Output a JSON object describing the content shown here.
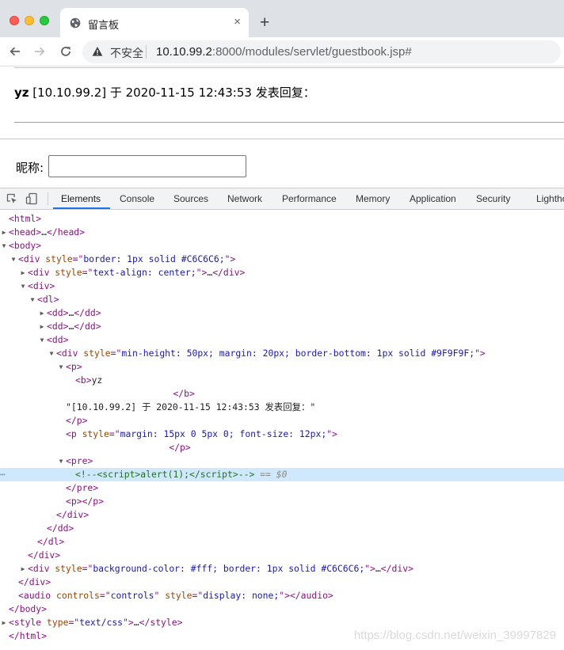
{
  "browser": {
    "tab_title": "留言板",
    "tab_close": "×",
    "new_tab": "+",
    "insecure_label": "不安全",
    "url_host": "10.10.99.2",
    "url_rest": ":8000/modules/servlet/guestbook.jsp#"
  },
  "page": {
    "reply_author": "yz",
    "reply_text": " [10.10.99.2] 于 2020-11-15 12:43:53 发表回复：",
    "nick_label": "昵称:",
    "nick_value": ""
  },
  "devtools": {
    "tabs": [
      "Elements",
      "Console",
      "Sources",
      "Network",
      "Performance",
      "Memory",
      "Application",
      "Security",
      "Lighthouse"
    ],
    "active_tab": "Elements"
  },
  "dom_lines": [
    {
      "depth": 0,
      "arrow": "",
      "html": "<span class=\"tag\">&lt;html&gt;</span>"
    },
    {
      "depth": 0,
      "arrow": "▶",
      "html": "<span class=\"tag\">&lt;head&gt;</span>…<span class=\"tag\">&lt;/head&gt;</span>"
    },
    {
      "depth": 0,
      "arrow": "▼",
      "html": "<span class=\"tag\">&lt;body&gt;</span>"
    },
    {
      "depth": 1,
      "arrow": "▼",
      "html": "<span class=\"tag\">&lt;div </span><span class=\"attr\">style</span><span class=\"tag\">=\"</span><span class=\"val\">border: 1px solid #C6C6C6;</span><span class=\"tag\">\"&gt;</span>"
    },
    {
      "depth": 2,
      "arrow": "▶",
      "html": "<span class=\"tag\">&lt;div </span><span class=\"attr\">style</span><span class=\"tag\">=\"</span><span class=\"val\">text-align: center;</span><span class=\"tag\">\"&gt;</span>…<span class=\"tag\">&lt;/div&gt;</span>"
    },
    {
      "depth": 2,
      "arrow": "▼",
      "html": "<span class=\"tag\">&lt;div&gt;</span>"
    },
    {
      "depth": 3,
      "arrow": "▼",
      "html": "<span class=\"tag\">&lt;dl&gt;</span>"
    },
    {
      "depth": 4,
      "arrow": "▶",
      "html": "<span class=\"tag\">&lt;dd&gt;</span>…<span class=\"tag\">&lt;/dd&gt;</span>"
    },
    {
      "depth": 4,
      "arrow": "▶",
      "html": "<span class=\"tag\">&lt;dd&gt;</span>…<span class=\"tag\">&lt;/dd&gt;</span>"
    },
    {
      "depth": 4,
      "arrow": "▼",
      "html": "<span class=\"tag\">&lt;dd&gt;</span>"
    },
    {
      "depth": 5,
      "arrow": "▼",
      "html": "<span class=\"tag\">&lt;div </span><span class=\"attr\">style</span><span class=\"tag\">=\"</span><span class=\"val\">min-height: 50px; margin: 20px; border-bottom: 1px solid #9F9F9F;</span><span class=\"tag\">\"&gt;</span>"
    },
    {
      "depth": 6,
      "arrow": "▼",
      "html": "<span class=\"tag\">&lt;p&gt;</span>"
    },
    {
      "depth": 7,
      "arrow": "",
      "html": "<span class=\"tag\">&lt;b&gt;</span><span class=\"txt\">yz</span>"
    },
    {
      "depth": 7,
      "arrow": "",
      "html": "                  <span class=\"tag\">&lt;/b&gt;</span>"
    },
    {
      "depth": 7,
      "arrow": "",
      "pad": -12,
      "html": "<span class=\"txt\">\"[10.10.99.2] 于 2020-11-15 12:43:53 发表回复：\"</span>"
    },
    {
      "depth": 6,
      "arrow": "",
      "html": "<span class=\"tag\">&lt;/p&gt;</span>"
    },
    {
      "depth": 6,
      "arrow": "",
      "html": "<span class=\"tag\">&lt;p </span><span class=\"attr\">style</span><span class=\"tag\">=\"</span><span class=\"val\">margin: 15px 0 5px 0; font-size: 12px;</span><span class=\"tag\">\"&gt;</span>"
    },
    {
      "depth": 6,
      "arrow": "",
      "html": "                   <span class=\"tag\">&lt;/p&gt;</span>"
    },
    {
      "depth": 6,
      "arrow": "▼",
      "html": "<span class=\"tag\">&lt;pre&gt;</span>"
    },
    {
      "depth": 7,
      "arrow": "",
      "sel": true,
      "html": "<span class=\"cmt\">&lt;!--&lt;script&gt;alert(1);&lt;/script&gt;--&gt;</span> <span class=\"dollar\">== $0</span>"
    },
    {
      "depth": 6,
      "arrow": "",
      "html": "<span class=\"tag\">&lt;/pre&gt;</span>"
    },
    {
      "depth": 6,
      "arrow": "",
      "html": "<span class=\"tag\">&lt;p&gt;&lt;/p&gt;</span>"
    },
    {
      "depth": 5,
      "arrow": "",
      "html": "<span class=\"tag\">&lt;/div&gt;</span>"
    },
    {
      "depth": 4,
      "arrow": "",
      "html": "<span class=\"tag\">&lt;/dd&gt;</span>"
    },
    {
      "depth": 3,
      "arrow": "",
      "html": "<span class=\"tag\">&lt;/dl&gt;</span>"
    },
    {
      "depth": 2,
      "arrow": "",
      "html": "<span class=\"tag\">&lt;/div&gt;</span>"
    },
    {
      "depth": 2,
      "arrow": "▶",
      "html": "<span class=\"tag\">&lt;div </span><span class=\"attr\">style</span><span class=\"tag\">=\"</span><span class=\"val\">background-color: #fff; border: 1px solid #C6C6C6;</span><span class=\"tag\">\"&gt;</span>…<span class=\"tag\">&lt;/div&gt;</span>"
    },
    {
      "depth": 1,
      "arrow": "",
      "html": "<span class=\"tag\">&lt;/div&gt;</span>"
    },
    {
      "depth": 1,
      "arrow": "",
      "html": "<span class=\"tag\">&lt;audio </span><span class=\"attr\">controls</span><span class=\"tag\">=\"</span><span class=\"val\">controls</span><span class=\"tag\">\" </span><span class=\"attr\">style</span><span class=\"tag\">=\"</span><span class=\"val\">display: none;</span><span class=\"tag\">\"&gt;&lt;/audio&gt;</span>"
    },
    {
      "depth": 0,
      "arrow": "",
      "html": "<span class=\"tag\">&lt;/body&gt;</span>"
    },
    {
      "depth": 0,
      "arrow": "▶",
      "html": "<span class=\"tag\">&lt;style </span><span class=\"attr\">type</span><span class=\"tag\">=\"</span><span class=\"val\">text/css</span><span class=\"tag\">\"&gt;</span>…<span class=\"tag\">&lt;/style&gt;</span>"
    },
    {
      "depth": 0,
      "arrow": "",
      "html": "<span class=\"tag\">&lt;/html&gt;</span>"
    }
  ],
  "selected_marker": "⋯",
  "watermark": "https://blog.csdn.net/weixin_39997829"
}
